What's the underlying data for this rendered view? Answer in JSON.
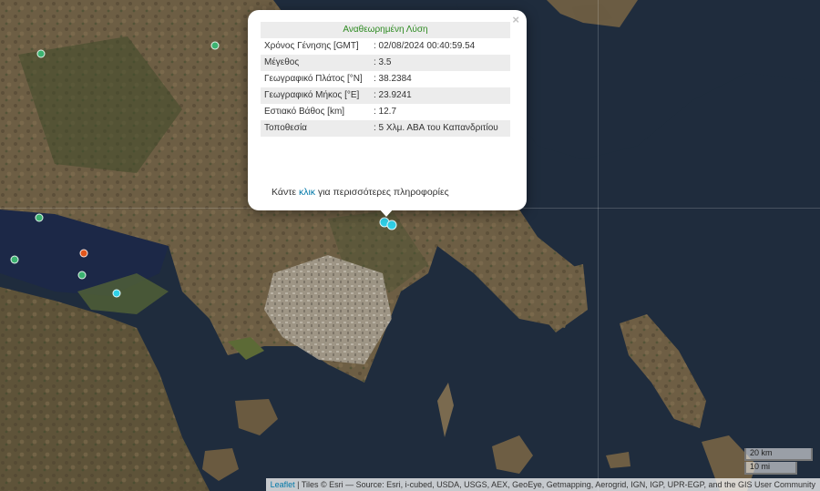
{
  "popup": {
    "title": "Αναθεωρημένη Λύση",
    "rows": [
      {
        "label": "Χρόνος Γένησης [GMT]",
        "value": ": 02/08/2024 00:40:59.54"
      },
      {
        "label": "Μέγεθος",
        "value": ": 3.5"
      },
      {
        "label": "Γεωγραφικό Πλάτος [°N]",
        "value": ": 38.2384"
      },
      {
        "label": "Γεωγραφικό Μήκος [°E]",
        "value": ": 23.9241"
      },
      {
        "label": "Εστιακό Βάθος [km]",
        "value": ": 12.7"
      },
      {
        "label": "Τοποθεσία",
        "value": ": 5 Χλμ. ΑΒΑ του Καπανδριτίου"
      }
    ],
    "more_prefix": "Κάντε ",
    "more_link": "κλικ",
    "more_suffix": " για περισσότερες πληροφορίες",
    "close": "×"
  },
  "markers": [
    {
      "color": "#3cb371"
    },
    {
      "color": "#3cb371"
    },
    {
      "color": "#3cb371"
    },
    {
      "color": "#3cb371"
    },
    {
      "color": "#e2561c"
    },
    {
      "color": "#3cb371"
    },
    {
      "color": "#2fd0e8"
    },
    {
      "color": "#2fd0e8"
    },
    {
      "color": "#2fd0e8"
    }
  ],
  "scale": {
    "km": "20 km",
    "mi": "10 mi"
  },
  "attribution": {
    "leaflet": "Leaflet",
    "text": " | Tiles © Esri — Source: Esri, i-cubed, USDA, USGS, AEX, GeoEye, Getmapping, Aerogrid, IGN, IGP, UPR-EGP, and the GIS User Community"
  },
  "colors": {
    "sea": "#1f2c3d",
    "land": "#6e6047",
    "vegetation": "#3f4a2a",
    "urban": "#9a9283"
  }
}
